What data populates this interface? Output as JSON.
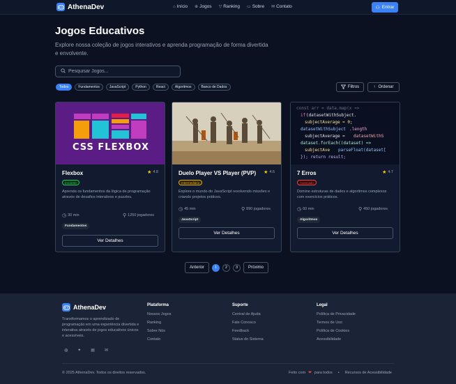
{
  "header": {
    "brand": "AthenaDev",
    "nav": [
      {
        "label": "Início",
        "icon": "home-icon"
      },
      {
        "label": "Jogos",
        "icon": "gamepad-icon"
      },
      {
        "label": "Ranking",
        "icon": "trophy-icon"
      },
      {
        "label": "Sobre",
        "icon": "book-icon"
      },
      {
        "label": "Contato",
        "icon": "mail-icon"
      }
    ],
    "enter_label": "Entrar"
  },
  "hero": {
    "title": "Jogos Educativos",
    "subtitle": "Explore nossa coleção de jogos interativos e aprenda programação de forma divertida e envolvente.",
    "search_placeholder": "Pesquisar Jogos..."
  },
  "filters": {
    "chips": [
      "Todos",
      "Fundamentos",
      "JavaScript",
      "Python",
      "React",
      "Algoritmos",
      "Banco de Dados"
    ],
    "active_chip": "Todos",
    "filters_label": "Filtros",
    "sort_label": "Ordenar"
  },
  "games": [
    {
      "title": "Flexbox",
      "image_text": "CSS FLEXBOX",
      "rating": "4.8",
      "level": "Iniciante",
      "level_color": "#22c55e",
      "description": "Aprenda os fundamentos da lógica de programação através de desafios interativos e puzzles.",
      "duration": "30 min",
      "players": "1250 jogadores",
      "tag": "Fundamentos",
      "button": "Ver Detalhes"
    },
    {
      "title": "Duelo Player VS Player (PVP)",
      "rating": "4.6",
      "level": "Intermediário",
      "level_color": "#eab308",
      "description": "Explore o mundo do JavaScript resolvendo missões e criando projetos práticos.",
      "duration": "45 min",
      "players": "890 jogadores",
      "tag": "JavaScript",
      "button": "Ver Detalhes"
    },
    {
      "title": "7 Erros",
      "rating": "4.7",
      "level": "Avançado",
      "level_color": "#ef4444",
      "description": "Domine estruturas de dados e algoritmos complexos com exercícios práticos.",
      "duration": "60 min",
      "players": "450 jogadores",
      "tag": "Algoritmos",
      "button": "Ver Detalhes"
    }
  ],
  "pagination": {
    "prev": "Anterior",
    "pages": [
      "1",
      "2",
      "3"
    ],
    "active": "1",
    "next": "Próximo"
  },
  "footer": {
    "brand": "AthenaDev",
    "description": "Transformamos o aprendizado de programação em uma experiência divertida e interativa através de jogos educativos únicos e acessíveis.",
    "columns": [
      {
        "title": "Plataforma",
        "links": [
          "Nossos Jogos",
          "Ranking",
          "Sobre Nós",
          "Contato"
        ]
      },
      {
        "title": "Suporte",
        "links": [
          "Central de Ajuda",
          "Fale Conosco",
          "Feedback",
          "Status do Sistema"
        ]
      },
      {
        "title": "Legal",
        "links": [
          "Política de Privacidade",
          "Termos de Uso",
          "Política de Cookies",
          "Acessibilidade"
        ]
      }
    ],
    "social": [
      "github-icon",
      "twitter-icon",
      "linkedin-icon",
      "mail-icon"
    ],
    "copyright": "© 2025 AthenaDev. Todos os direitos reservados.",
    "made_with_prefix": "Feito com",
    "made_with_suffix": "para todos",
    "accessibility": "Recursos de Acessibilidade"
  }
}
